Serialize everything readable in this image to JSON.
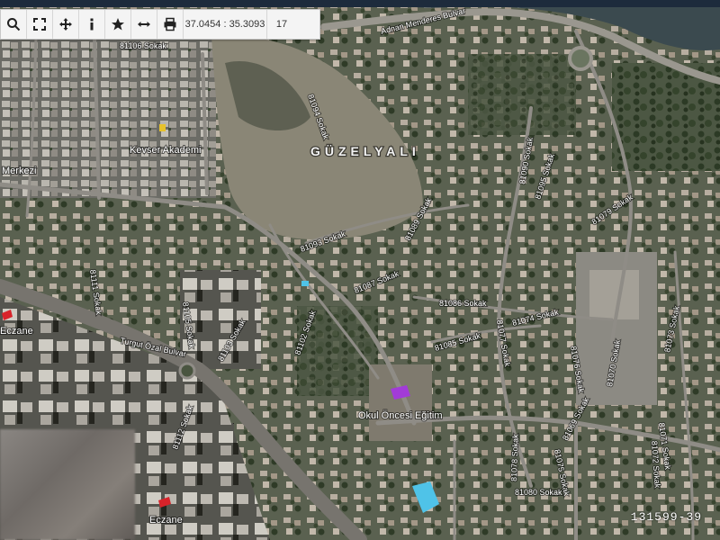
{
  "toolbar": {
    "coordinates": "37.0454 : 35.3093",
    "zoom_level": "17",
    "buttons": [
      {
        "icon": "search-icon"
      },
      {
        "icon": "fullscreen-icon"
      },
      {
        "icon": "move-icon"
      },
      {
        "icon": "info-icon"
      },
      {
        "icon": "star-icon"
      },
      {
        "icon": "measure-icon"
      },
      {
        "icon": "print-icon"
      }
    ]
  },
  "map": {
    "district": "GÜZELYALI",
    "roads": {
      "r1": "Adnan Menderes Bulvar",
      "r2": "81106 Sokak",
      "r3": "81094 Sokak",
      "r4": "81093 Sokak",
      "r5": "81089 Sokak",
      "r6": "81087 Sokak",
      "r7": "81090 Sokak",
      "r8": "81095 Sokak",
      "r9": "81079 Sokak",
      "r10": "81086 Sokak",
      "r11": "81074 Sokak",
      "r12": "81085 Sokak",
      "r13": "81077 Sokak",
      "r14": "81073 Sokak",
      "r15": "81076 Sokak",
      "r16": "81070 Sokak",
      "r17": "81071 Sokak",
      "r18": "81102 Sokak",
      "r19": "81103 Sokak",
      "r20": "81105 Sokak",
      "r21": "81111 Sokak",
      "r22": "Turgut Özal Bulvar",
      "r23": "81112 Sokak",
      "r24": "81078 Sokak",
      "r25": "81075 Sokak",
      "r26": "81080 Sokak",
      "r27": "81069 Sokak",
      "r28": "81072 Sokak"
    },
    "places": {
      "p1": "Kevser Akademi",
      "p2": "Merkezi",
      "p3": "Okul Öncesi Eğitim",
      "p4": "Eczane",
      "p5": "Eczane"
    },
    "colors": {
      "marker_pharmacy": "#d8232a",
      "marker_school": "#a23bd8",
      "marker_academy": "#e7c22b",
      "pool": "#4fc3e8"
    }
  },
  "watermark": "131599-39"
}
